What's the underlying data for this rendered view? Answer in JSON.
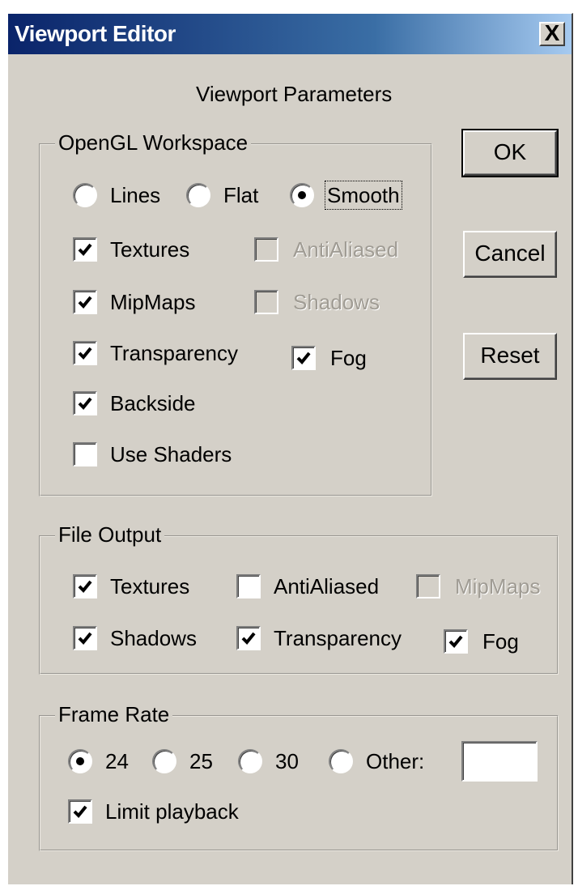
{
  "window": {
    "title": "Viewport Editor",
    "close_label": "X"
  },
  "heading": "Viewport Parameters",
  "opengl": {
    "legend": "OpenGL Workspace",
    "render_modes": [
      {
        "label": "Lines",
        "selected": false
      },
      {
        "label": "Flat",
        "selected": false
      },
      {
        "label": "Smooth",
        "selected": true
      }
    ],
    "textures": "Textures",
    "antialiased": "AntiAliased",
    "mipmaps": "MipMaps",
    "shadows": "Shadows",
    "transparency": "Transparency",
    "fog": "Fog",
    "backside": "Backside",
    "use_shaders": "Use Shaders",
    "checked": {
      "textures": true,
      "antialiased": false,
      "mipmaps": true,
      "shadows": false,
      "transparency": true,
      "fog": true,
      "backside": true,
      "use_shaders": false
    },
    "disabled": [
      "antialiased",
      "shadows"
    ]
  },
  "buttons": {
    "ok": "OK",
    "cancel": "Cancel",
    "reset": "Reset"
  },
  "file_output": {
    "legend": "File Output",
    "textures": "Textures",
    "antialiased": "AntiAliased",
    "mipmaps": "MipMaps",
    "shadows": "Shadows",
    "transparency": "Transparency",
    "fog": "Fog",
    "checked": {
      "textures": true,
      "antialiased": false,
      "mipmaps": false,
      "shadows": true,
      "transparency": true,
      "fog": true
    },
    "disabled": [
      "mipmaps"
    ]
  },
  "frame_rate": {
    "legend": "Frame Rate",
    "options": [
      {
        "label": "24",
        "selected": true
      },
      {
        "label": "25",
        "selected": false
      },
      {
        "label": "30",
        "selected": false
      },
      {
        "label": "Other:",
        "selected": false
      }
    ],
    "other_value": "",
    "limit_playback": "Limit playback",
    "limit_checked": true
  }
}
